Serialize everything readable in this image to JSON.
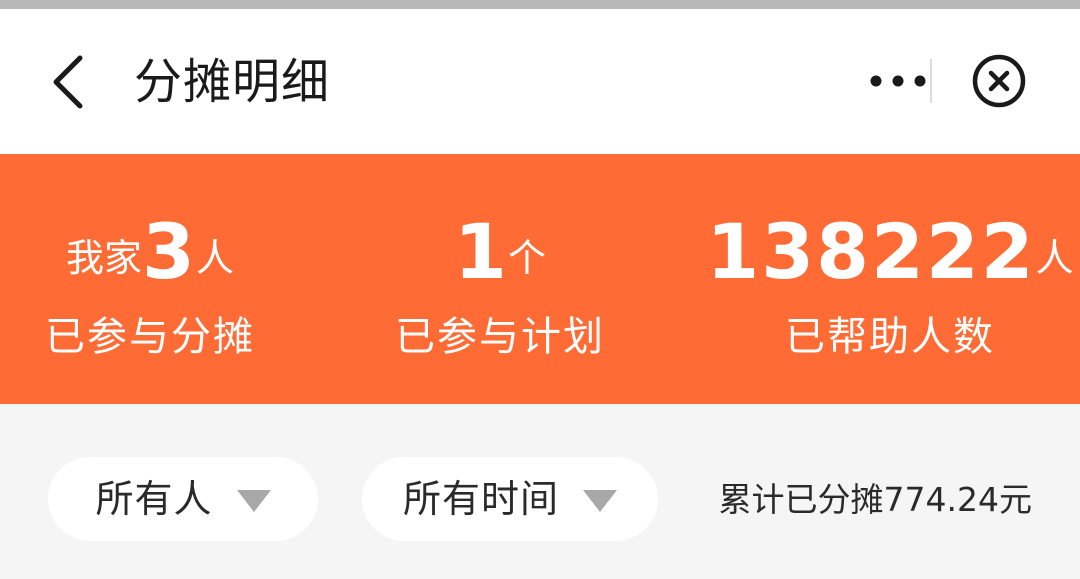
{
  "header": {
    "title": "分摊明细"
  },
  "stats": [
    {
      "prefix": "我家",
      "number": "3",
      "unit": "人",
      "label": "已参与分摊"
    },
    {
      "prefix": "",
      "number": "1",
      "unit": "个",
      "label": "已参与计划"
    },
    {
      "prefix": "",
      "number": "138222",
      "unit": "人",
      "label": "已帮助人数"
    }
  ],
  "filters": {
    "people": {
      "label": "所有人"
    },
    "time": {
      "label": "所有时间"
    }
  },
  "summary": {
    "total_text": "累计已分摊774.24元"
  },
  "colors": {
    "accent": "#ff6b35",
    "header_bg": "#ffffff",
    "page_bg": "#f5f5f5",
    "text": "#222222",
    "arrow": "#a8a8a8"
  },
  "icons": {
    "back": "back-arrow-icon",
    "more": "more-dots-icon",
    "close": "close-circle-icon",
    "dropdown": "dropdown-triangle-icon"
  }
}
